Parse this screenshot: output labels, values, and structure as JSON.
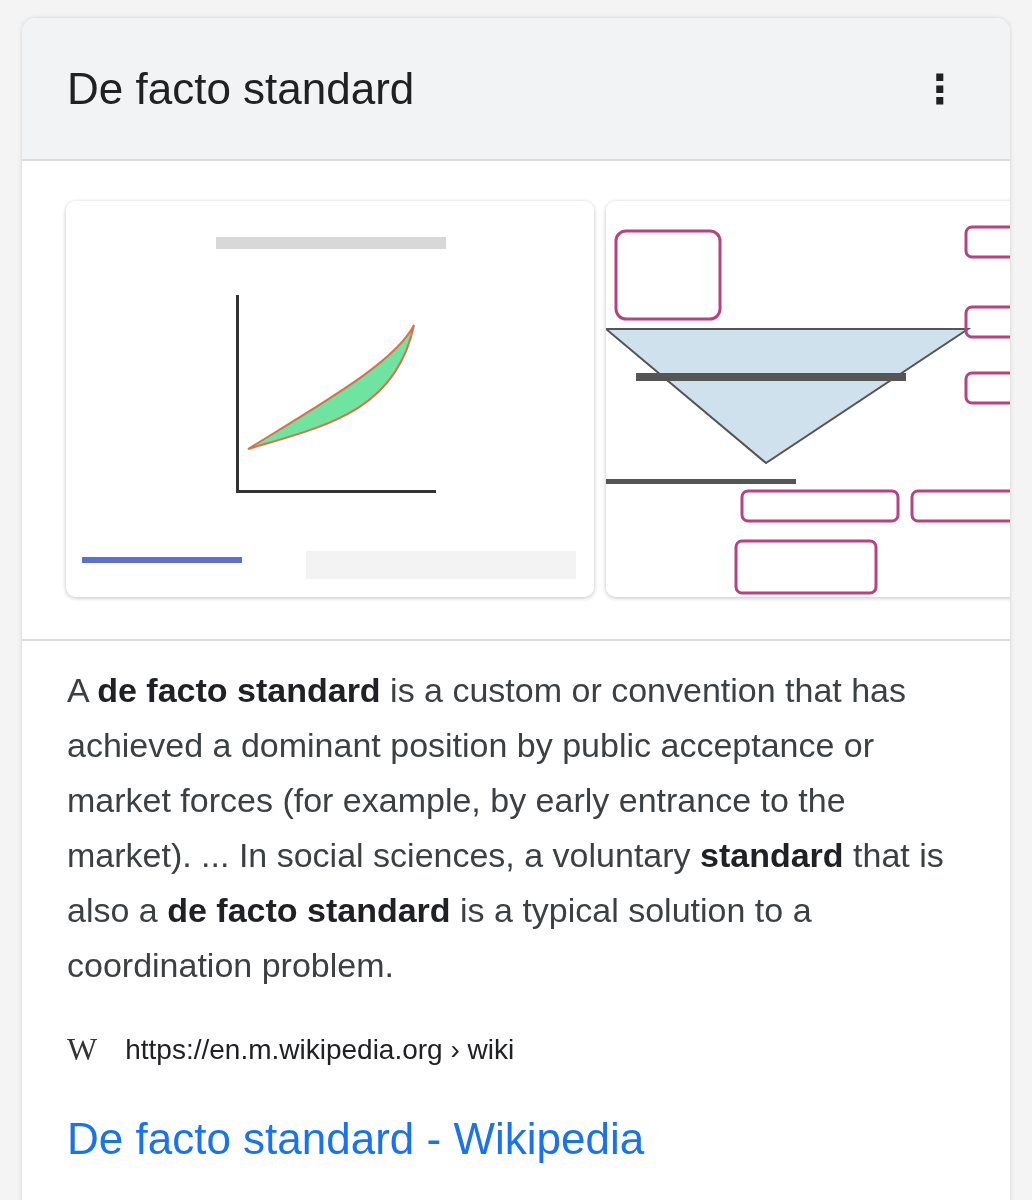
{
  "card": {
    "title": "De facto standard",
    "menu_icon": "⋮"
  },
  "description": "A **de facto standard** is a custom or convention that has achieved a dominant position by public acceptance or market forces (for example, by early entrance to the market). ... In social sciences, a voluntary **standard** that is also a **de facto standard** is a typical solution to a coordination problem.",
  "source": {
    "icon": "W",
    "url": "https://en.m.wikipedia.org › wiki"
  },
  "result_link": "De facto standard - Wikipedia"
}
